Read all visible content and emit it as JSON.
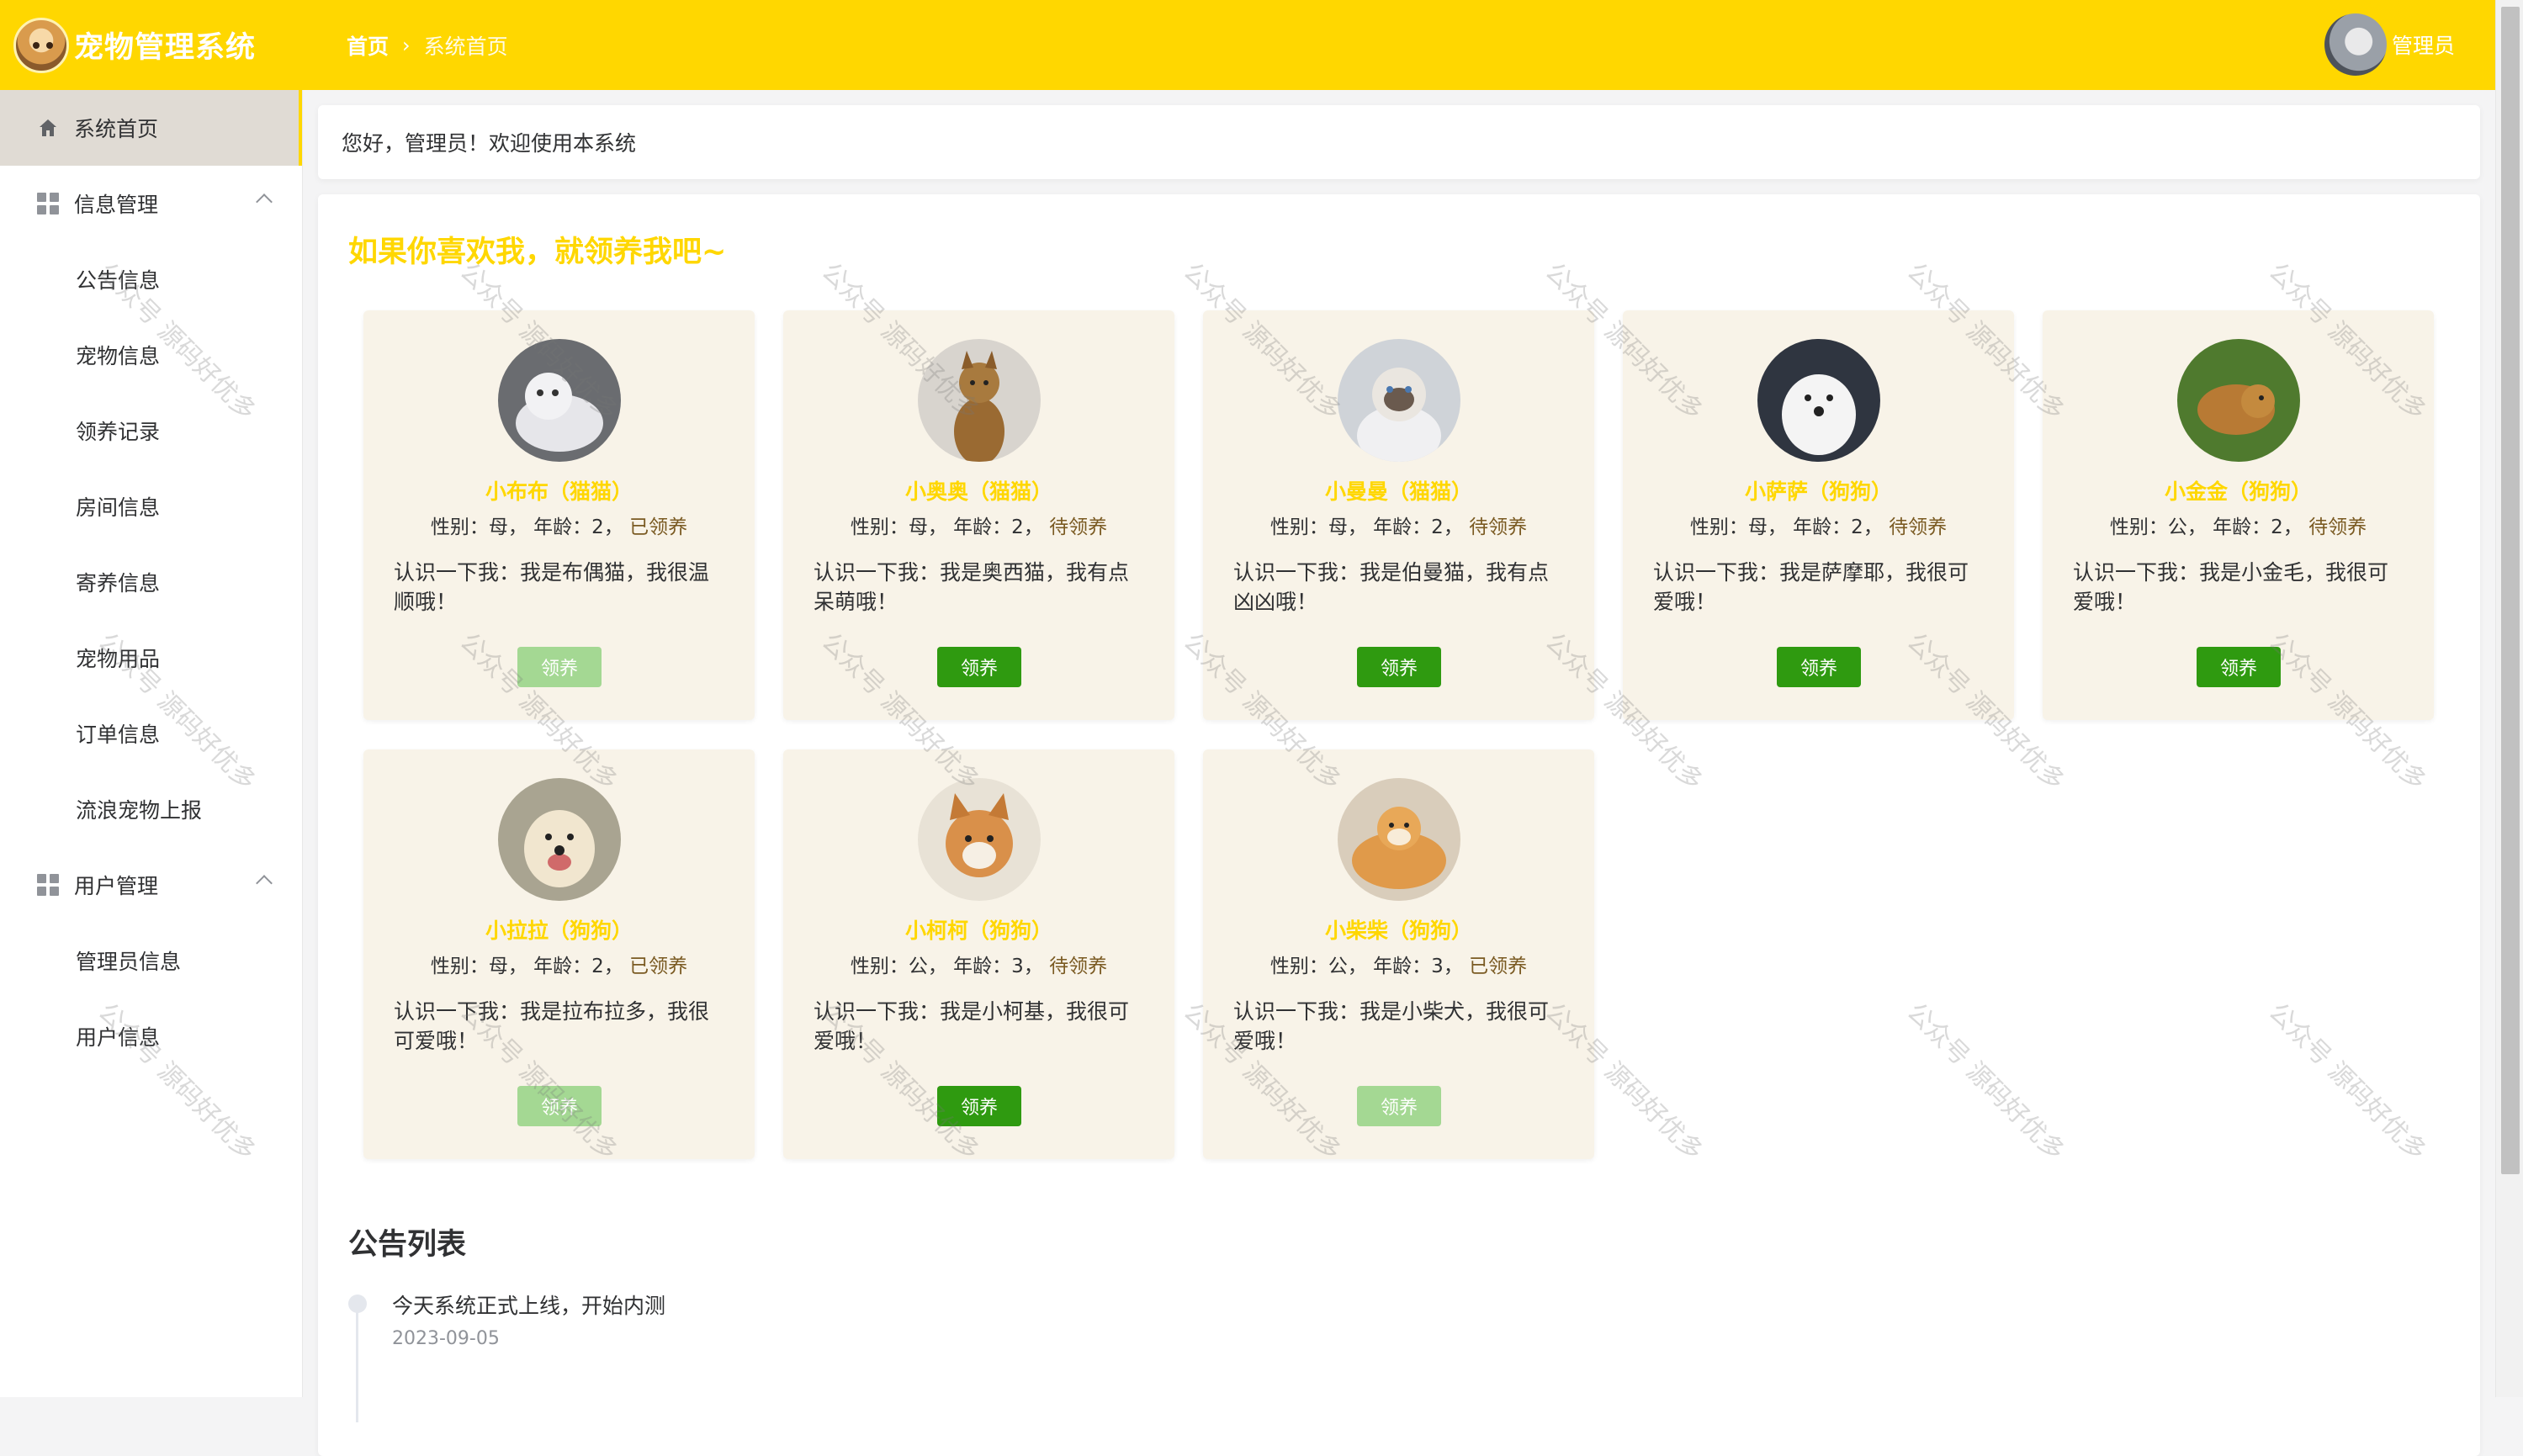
{
  "header": {
    "app_title": "宠物管理系统",
    "breadcrumb_home": "首页",
    "breadcrumb_sep": "›",
    "breadcrumb_current": "系统首页",
    "user_name": "管理员",
    "color": "#ffd700"
  },
  "sidebar": {
    "home": "系统首页",
    "groups": [
      {
        "title": "信息管理",
        "items": [
          "公告信息",
          "宠物信息",
          "领养记录",
          "房间信息",
          "寄养信息",
          "宠物用品",
          "订单信息",
          "流浪宠物上报"
        ]
      },
      {
        "title": "用户管理",
        "items": [
          "管理员信息",
          "用户信息"
        ]
      }
    ]
  },
  "welcome": "您好，管理员！欢迎使用本系统",
  "section_title": "如果你喜欢我，就领养我吧~",
  "adopt_label": "领养",
  "pets": [
    {
      "name": "小布布（猫猫）",
      "gender": "母",
      "age": "2",
      "status": "已领养",
      "intro": "认识一下我：我是布偶猫，我很温顺哦！",
      "adopted": true,
      "avatar_icon": "ragdoll-cat-photo"
    },
    {
      "name": "小奥奥（猫猫）",
      "gender": "母",
      "age": "2",
      "status": "待领养",
      "intro": "认识一下我：我是奥西猫，我有点呆萌哦！",
      "adopted": false,
      "avatar_icon": "ocicat-photo"
    },
    {
      "name": "小曼曼（猫猫）",
      "gender": "母",
      "age": "2",
      "status": "待领养",
      "intro": "认识一下我：我是伯曼猫，我有点凶凶哦！",
      "adopted": false,
      "avatar_icon": "birman-cat-photo"
    },
    {
      "name": "小萨萨（狗狗）",
      "gender": "母",
      "age": "2",
      "status": "待领养",
      "intro": "认识一下我：我是萨摩耶，我很可爱哦！",
      "adopted": false,
      "avatar_icon": "samoyed-photo"
    },
    {
      "name": "小金金（狗狗）",
      "gender": "公",
      "age": "2",
      "status": "待领养",
      "intro": "认识一下我：我是小金毛，我很可爱哦！",
      "adopted": false,
      "avatar_icon": "golden-retriever-photo"
    },
    {
      "name": "小拉拉（狗狗）",
      "gender": "母",
      "age": "2",
      "status": "已领养",
      "intro": "认识一下我：我是拉布拉多，我很可爱哦！",
      "adopted": true,
      "avatar_icon": "labrador-photo"
    },
    {
      "name": "小柯柯（狗狗）",
      "gender": "公",
      "age": "3",
      "status": "待领养",
      "intro": "认识一下我：我是小柯基，我很可爱哦！",
      "adopted": false,
      "avatar_icon": "corgi-photo"
    },
    {
      "name": "小柴柴（狗狗）",
      "gender": "公",
      "age": "3",
      "status": "已领养",
      "intro": "认识一下我：我是小柴犬，我很可爱哦！",
      "adopted": true,
      "avatar_icon": "shiba-photo"
    }
  ],
  "notice_title": "公告列表",
  "notices": [
    {
      "text": "今天系统正式上线，开始内测",
      "date": "2023-09-05"
    }
  ],
  "watermark": "公众号 源码好优多",
  "colors": {
    "accent": "#ffd700",
    "adopt_button": "#2f9a10",
    "adopt_button_disabled": "#a4d893",
    "card_bg": "#f8f3e8"
  }
}
